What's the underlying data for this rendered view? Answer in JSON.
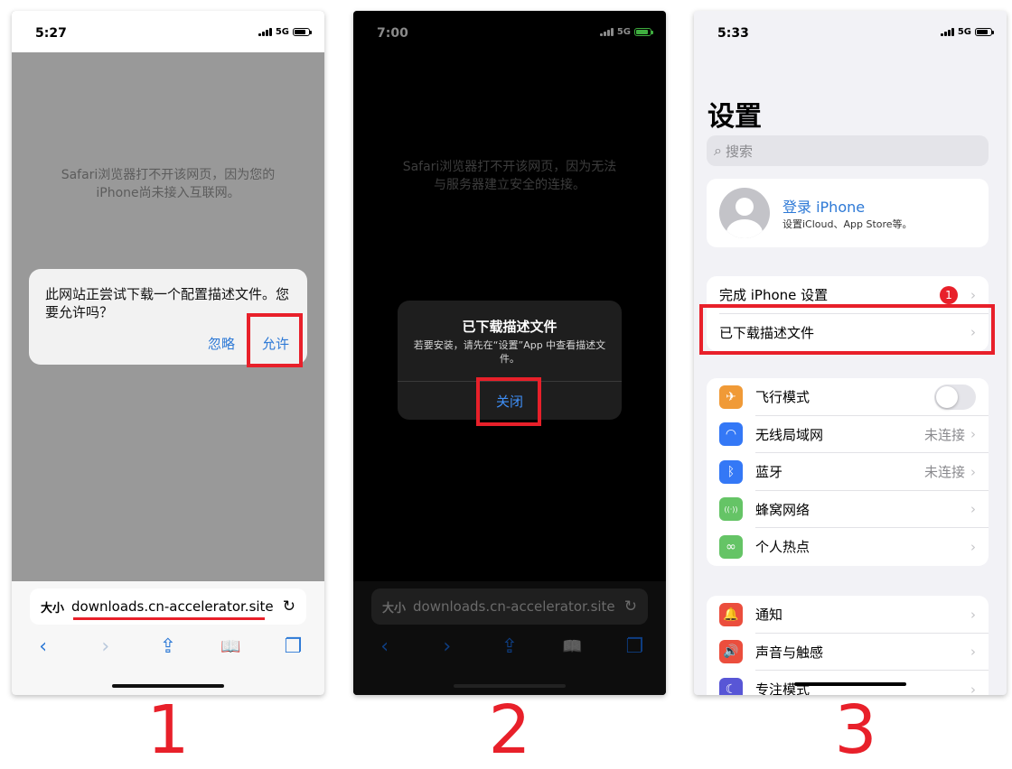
{
  "phone1": {
    "status": {
      "time": "5:27",
      "network": "5G"
    },
    "error_message": "Safari浏览器打不开该网页，因为您的iPhone尚未接入互联网。",
    "alert": {
      "message": "此网站正尝试下载一个配置描述文件。您要允许吗？",
      "ignore_label": "忽略",
      "allow_label": "允许"
    },
    "address_bar": {
      "text_size_label": "大小",
      "url": "downloads.cn-accelerator.site",
      "reload_icon": "↻"
    },
    "toolbar": {
      "back_icon": "‹",
      "forward_icon": "›",
      "share_icon": "⇪",
      "bookmarks_icon": "📖",
      "tabs_icon": "❐"
    },
    "step_label": "1"
  },
  "phone2": {
    "status": {
      "time": "7:00",
      "network": "5G"
    },
    "error_message": "Safari浏览器打不开该网页，因为无法与服务器建立安全的连接。",
    "alert": {
      "title": "已下载描述文件",
      "body": "若要安装，请先在“设置”App 中查看描述文件。",
      "close_label": "关闭"
    },
    "address_bar": {
      "text_size_label": "大小",
      "url": "downloads.cn-accelerator.site",
      "reload_icon": "↻"
    },
    "toolbar": {
      "back_icon": "‹",
      "forward_icon": "›",
      "share_icon": "⇪",
      "bookmarks_icon": "📖",
      "tabs_icon": "❐"
    },
    "step_label": "2"
  },
  "phone3": {
    "status": {
      "time": "5:33",
      "network": "5G"
    },
    "title": "设置",
    "search_placeholder": "搜索",
    "account": {
      "name": "登录 iPhone",
      "subtitle": "设置iCloud、App Store等。"
    },
    "setup_group": [
      {
        "label": "完成 iPhone 设置",
        "badge": "1"
      },
      {
        "label": "已下载描述文件"
      }
    ],
    "network_group": [
      {
        "label": "飞行模式",
        "icon": "airplane-icon",
        "glyph": "✈",
        "color": "#f09a37"
      },
      {
        "label": "无线局域网",
        "value": "未连接",
        "icon": "wifi-icon",
        "glyph": "◠",
        "color": "#3478f6"
      },
      {
        "label": "蓝牙",
        "value": "未连接",
        "icon": "bluetooth-icon",
        "glyph": "ᛒ",
        "color": "#3478f6"
      },
      {
        "label": "蜂窝网络",
        "icon": "cellular-icon",
        "glyph": "((·))",
        "color": "#65c466"
      },
      {
        "label": "个人热点",
        "icon": "hotspot-icon",
        "glyph": "∞",
        "color": "#65c466"
      }
    ],
    "notify_group": [
      {
        "label": "通知",
        "icon": "bell-icon",
        "glyph": "🔔",
        "color": "#eb4e3d"
      },
      {
        "label": "声音与触感",
        "icon": "speaker-icon",
        "glyph": "🔊",
        "color": "#eb4e3d"
      },
      {
        "label": "专注模式",
        "icon": "moon-icon",
        "glyph": "☾",
        "color": "#5856d6"
      }
    ],
    "step_label": "3"
  },
  "colors": {
    "highlight": "#e8202a",
    "link_blue": "#2d79d6",
    "dark_blue": "#3f8ff7"
  }
}
